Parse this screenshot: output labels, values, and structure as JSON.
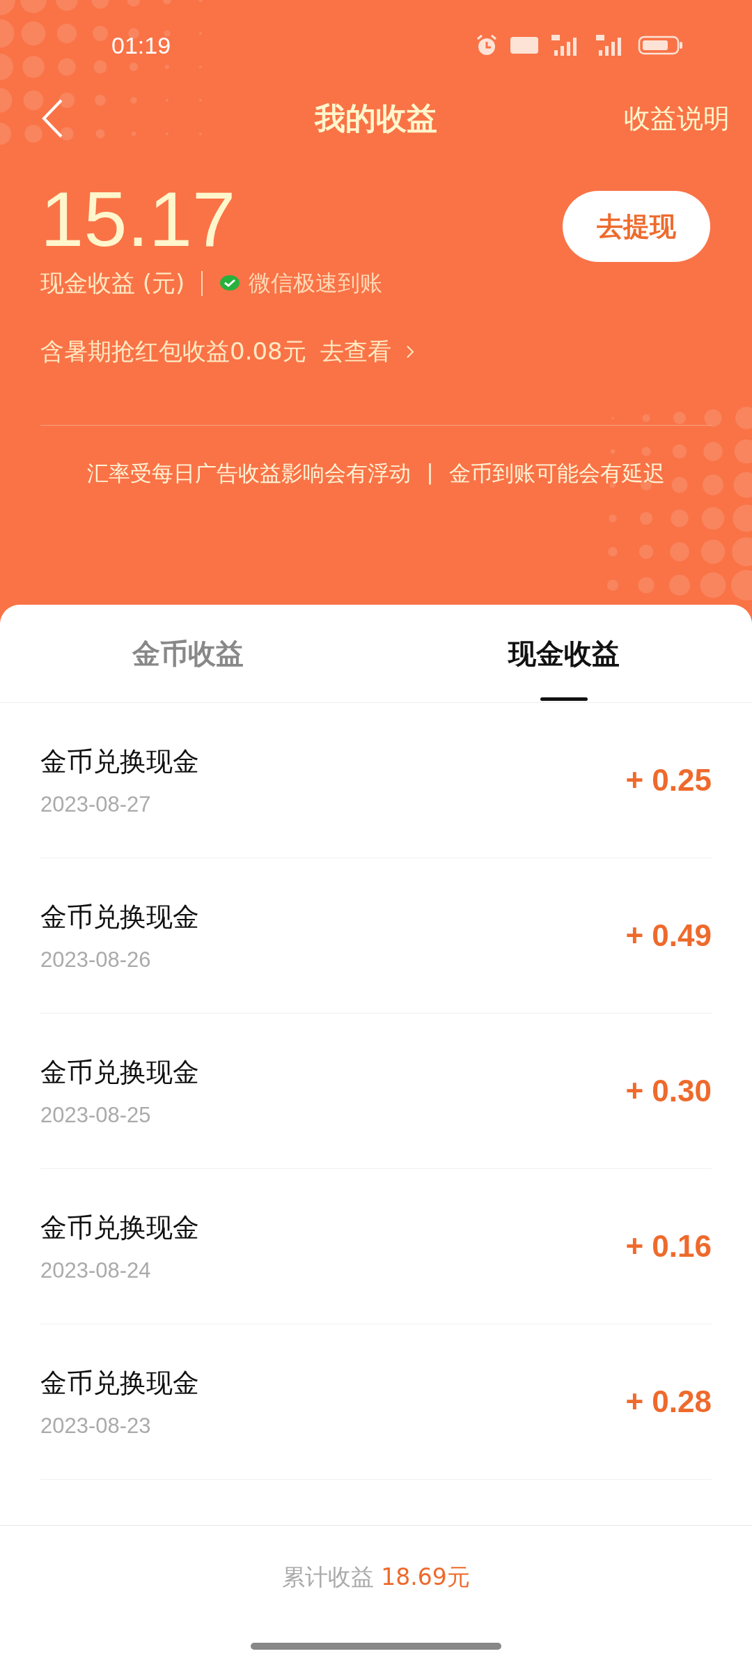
{
  "status_bar": {
    "time": "01:19"
  },
  "header": {
    "title": "我的收益",
    "action": "收益说明"
  },
  "balance": {
    "amount": "15.17",
    "label": "现金收益 (元)",
    "wechat_note": "微信极速到账",
    "withdraw_button": "去提现"
  },
  "promo": {
    "text": "含暑期抢红包收益0.08元",
    "link": "去查看"
  },
  "notice": {
    "left": "汇率受每日广告收益影响会有浮动",
    "separator": "|",
    "right": "金币到账可能会有延迟"
  },
  "tabs": [
    {
      "label": "金币收益",
      "selected": false
    },
    {
      "label": "现金收益",
      "selected": true
    }
  ],
  "records": [
    {
      "title": "金币兑换现金",
      "date": "2023-08-27",
      "amount": "+ 0.25"
    },
    {
      "title": "金币兑换现金",
      "date": "2023-08-26",
      "amount": "+ 0.49"
    },
    {
      "title": "金币兑换现金",
      "date": "2023-08-25",
      "amount": "+ 0.30"
    },
    {
      "title": "金币兑换现金",
      "date": "2023-08-24",
      "amount": "+ 0.16"
    },
    {
      "title": "金币兑换现金",
      "date": "2023-08-23",
      "amount": "+ 0.28"
    }
  ],
  "footer": {
    "label": "累计收益",
    "total": "18.69元"
  }
}
